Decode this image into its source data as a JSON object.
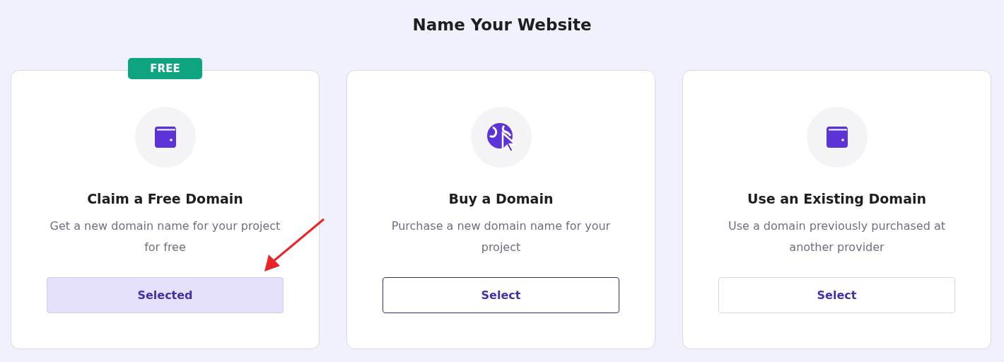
{
  "page": {
    "title": "Name Your Website"
  },
  "options": [
    {
      "badge": "FREE",
      "kind": "wallet",
      "heading": "Claim a Free Domain",
      "description": "Get a new domain name for your project for free",
      "button": "Selected",
      "selected": true,
      "focused": false
    },
    {
      "kind": "globe-cursor",
      "heading": "Buy a Domain",
      "description": "Purchase a new domain name for your project",
      "button": "Select",
      "selected": false,
      "focused": true
    },
    {
      "kind": "wallet",
      "heading": "Use an Existing Domain",
      "description": "Use a domain previously purchased at another provider",
      "button": "Select",
      "selected": false,
      "focused": false
    }
  ]
}
